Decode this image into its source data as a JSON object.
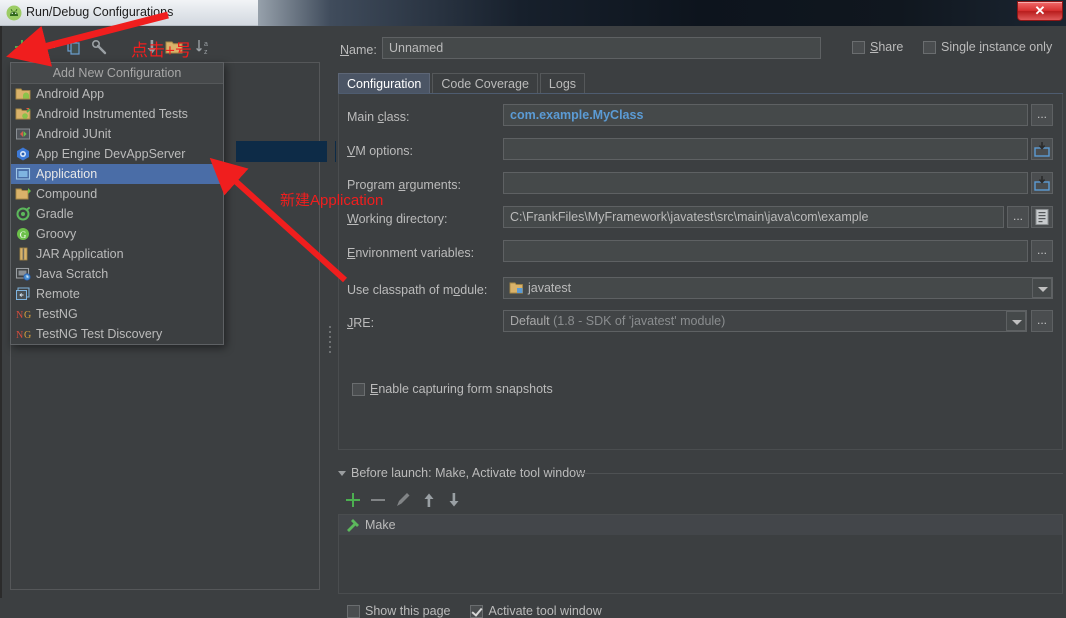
{
  "window": {
    "title": "Run/Debug Configurations",
    "icon": "android-studio-icon",
    "close_label": "✕"
  },
  "left_toolbar": {
    "items": [
      {
        "name": "add-configuration-button",
        "icon": "plus-icon",
        "label": "+"
      },
      {
        "name": "remove-configuration-button",
        "icon": "minus-icon",
        "label": "−"
      },
      {
        "name": "copy-configuration-button",
        "icon": "copy-icon",
        "label": ""
      },
      {
        "name": "edit-templates-button",
        "icon": "wrench-icon",
        "label": ""
      },
      {
        "name": "move-down-button",
        "icon": "arrow-down-icon",
        "label": ""
      },
      {
        "name": "create-folder-button",
        "icon": "folder-icon",
        "label": ""
      },
      {
        "name": "sort-configurations-button",
        "icon": "sort-az-icon",
        "label": ""
      }
    ]
  },
  "popup": {
    "header": "Add New Configuration",
    "selected": "Application",
    "items": [
      {
        "label": "Android App",
        "icon": "android-folder-icon"
      },
      {
        "label": "Android Instrumented Tests",
        "icon": "android-test-icon"
      },
      {
        "label": "Android JUnit",
        "icon": "junit-icon"
      },
      {
        "label": "App Engine DevAppServer",
        "icon": "app-engine-icon"
      },
      {
        "label": "Application",
        "icon": "application-icon"
      },
      {
        "label": "Compound",
        "icon": "compound-folder-icon"
      },
      {
        "label": "Gradle",
        "icon": "gradle-icon"
      },
      {
        "label": "Groovy",
        "icon": "groovy-icon"
      },
      {
        "label": "JAR Application",
        "icon": "jar-icon"
      },
      {
        "label": "Java Scratch",
        "icon": "java-scratch-icon"
      },
      {
        "label": "Remote",
        "icon": "remote-icon"
      },
      {
        "label": "TestNG",
        "icon": "testng-icon"
      },
      {
        "label": "TestNG Test Discovery",
        "icon": "testng-discovery-icon"
      }
    ]
  },
  "form": {
    "name_label": "Name:",
    "name_value": "Unnamed",
    "share_label": "Share",
    "share_checked": false,
    "single_instance_label": "Single instance only",
    "single_instance_checked": false,
    "tabs": [
      {
        "label": "Configuration",
        "active": true
      },
      {
        "label": "Code Coverage",
        "active": false
      },
      {
        "label": "Logs",
        "active": false
      }
    ],
    "fields": {
      "main_class_label": "Main class:",
      "main_class_value": "com.example.MyClass",
      "vm_options_label": "VM options:",
      "vm_options_value": "",
      "program_arguments_label": "Program arguments:",
      "program_arguments_value": "",
      "working_directory_label": "Working directory:",
      "working_directory_value": "C:\\FrankFiles\\MyFramework\\javatest\\src\\main\\java\\com\\example",
      "environment_variables_label": "Environment variables:",
      "environment_variables_value": "",
      "classpath_module_label": "Use classpath of module:",
      "classpath_module_value": "javatest",
      "jre_label": "JRE:",
      "jre_value": "Default",
      "jre_value_detail": "(1.8 - SDK of 'javatest' module)",
      "browse_label": "...",
      "enable_snapshots_label": "Enable capturing form snapshots",
      "enable_snapshots_checked": false
    }
  },
  "before_launch": {
    "header": "Before launch: Make, Activate tool window",
    "toolbar": [
      {
        "name": "add-task-button",
        "icon": "plus-icon"
      },
      {
        "name": "remove-task-button",
        "icon": "minus-icon"
      },
      {
        "name": "edit-task-button",
        "icon": "pencil-icon"
      },
      {
        "name": "move-task-up-button",
        "icon": "arrow-up-icon"
      },
      {
        "name": "move-task-down-button",
        "icon": "arrow-down-icon"
      }
    ],
    "tasks": [
      {
        "label": "Make",
        "icon": "hammer-icon"
      }
    ],
    "show_page_label": "Show this page",
    "show_page_checked": false,
    "activate_tool_window_label": "Activate tool window",
    "activate_tool_window_checked": true
  },
  "annotations": [
    {
      "text": "点击+号",
      "name": "annotation-click-plus"
    },
    {
      "text": "新建Application",
      "name": "annotation-new-application"
    }
  ],
  "colors": {
    "accent_blue": "#4a6da7",
    "annotation_red": "#f01e1e",
    "link_blue": "#5b9bd5",
    "panel_bg": "#3c3f41"
  }
}
